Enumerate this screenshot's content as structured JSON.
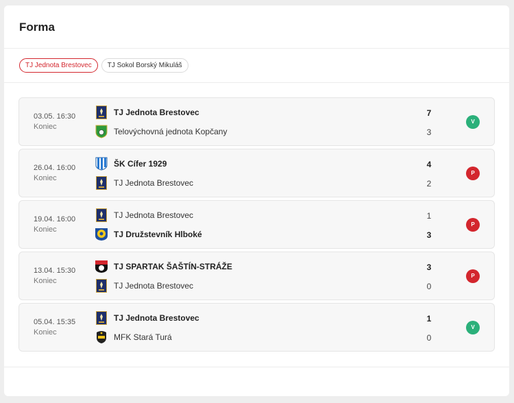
{
  "title": "Forma",
  "tabs": [
    {
      "label": "TJ Jednota Brestovec",
      "active": true
    },
    {
      "label": "TJ Sokol Borský Mikuláš",
      "active": false
    }
  ],
  "colors": {
    "accent": "#d3262d",
    "win": "#2bb07a",
    "loss": "#d3262d"
  },
  "matches": [
    {
      "date": "03.05. 16:30",
      "status": "Koniec",
      "home": {
        "name": "TJ Jednota Brestovec",
        "score": "7",
        "icon": "brestovec-crest-icon",
        "winner": true
      },
      "away": {
        "name": "Telovýchovná jednota Kopčany",
        "score": "3",
        "icon": "kopcany-crest-icon",
        "winner": false
      },
      "result": "V"
    },
    {
      "date": "26.04. 16:00",
      "status": "Koniec",
      "home": {
        "name": "ŠK Cífer 1929",
        "score": "4",
        "icon": "cifer-crest-icon",
        "winner": true
      },
      "away": {
        "name": "TJ Jednota Brestovec",
        "score": "2",
        "icon": "brestovec-crest-icon",
        "winner": false
      },
      "result": "P"
    },
    {
      "date": "19.04. 16:00",
      "status": "Koniec",
      "home": {
        "name": "TJ Jednota Brestovec",
        "score": "1",
        "icon": "brestovec-crest-icon",
        "winner": false
      },
      "away": {
        "name": "TJ Družstevník Hlboké",
        "score": "3",
        "icon": "hlboke-crest-icon",
        "winner": true
      },
      "result": "P"
    },
    {
      "date": "13.04. 15:30",
      "status": "Koniec",
      "home": {
        "name": "TJ SPARTAK ŠAŠTÍN-STRÁŽE",
        "score": "3",
        "icon": "sastin-crest-icon",
        "winner": true
      },
      "away": {
        "name": "TJ Jednota Brestovec",
        "score": "0",
        "icon": "brestovec-crest-icon",
        "winner": false
      },
      "result": "P"
    },
    {
      "date": "05.04. 15:35",
      "status": "Koniec",
      "home": {
        "name": "TJ Jednota Brestovec",
        "score": "1",
        "icon": "brestovec-crest-icon",
        "winner": true
      },
      "away": {
        "name": "MFK Stará Turá",
        "score": "0",
        "icon": "stara-tura-crest-icon",
        "winner": false
      },
      "result": "V"
    }
  ]
}
